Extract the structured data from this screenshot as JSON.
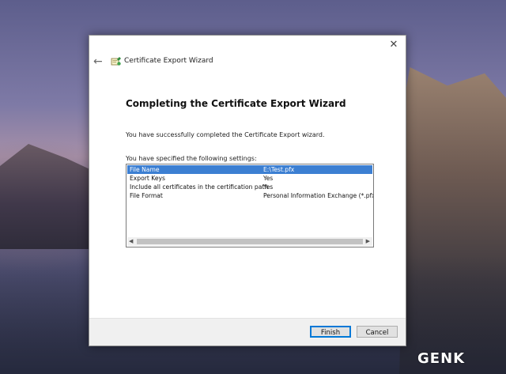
{
  "window": {
    "close_glyph": "✕",
    "back_glyph": "←",
    "title": "Certificate Export Wizard",
    "icon": "certificate-wizard-icon"
  },
  "content": {
    "heading": "Completing the Certificate Export Wizard",
    "message": "You have successfully completed the Certificate Export wizard.",
    "settings_label": "You have specified the following settings:",
    "settings": [
      {
        "name": "File Name",
        "value": "E:\\Test.pfx",
        "selected": true
      },
      {
        "name": "Export Keys",
        "value": "Yes"
      },
      {
        "name": "Include all certificates in the certification path",
        "value": "Yes"
      },
      {
        "name": "File Format",
        "value": "Personal Information Exchange (*.pfx)"
      }
    ]
  },
  "footer": {
    "finish_label": "Finish",
    "cancel_label": "Cancel"
  },
  "logo": {
    "text": "GENK"
  },
  "colors": {
    "selection": "#3c7fd2",
    "accent_border": "#0078d7"
  }
}
